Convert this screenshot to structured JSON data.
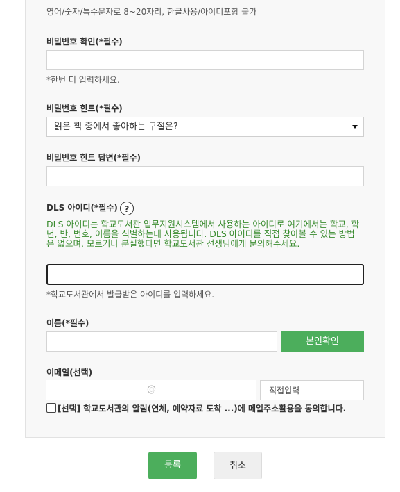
{
  "password_rule": "영어/숫자/특수문자로 8~20자리, 한글사용/아이디포함 불가",
  "password_confirm": {
    "label": "비밀번호 확인(*필수)",
    "value": "",
    "note": "*한번 더 입력하세요."
  },
  "password_hint": {
    "label": "비밀번호 힌트(*필수)",
    "selected": "읽은 책 중에서 좋아하는 구절은?"
  },
  "password_hint_answer": {
    "label": "비밀번호 힌트 답변(*필수)",
    "value": ""
  },
  "dls": {
    "label": "DLS 아이디(*필수)",
    "help": "?",
    "description": "DLS 아이디는 학교도서관 업무지원시스템에서 사용하는 아이디로 여기에서는 학교, 학년, 반, 번호, 이름을 식별하는데 사용됩니다. DLS 아이디를 직접 찾아볼 수 있는 방법은 없으며, 모르거나 분실했다면 학교도서관 선생님에게 문의해주세요.",
    "value": "",
    "note": "*학교도서관에서 발급받은 아이디를 입력하세요."
  },
  "name": {
    "label": "이름(*필수)",
    "value": "",
    "verify_button": "본인확인"
  },
  "email": {
    "label": "이메일(선택)",
    "local": "",
    "at": "@",
    "domain_select": "직접입력"
  },
  "agree": {
    "text": "[선택] 학교도서관의 알림(연체, 예약자료 도착 ...)에 메일주소활용을 동의합니다."
  },
  "buttons": {
    "submit": "등록",
    "cancel": "취소"
  },
  "colors": {
    "accent": "#4cae5c",
    "description_text": "#3a8c2f"
  }
}
